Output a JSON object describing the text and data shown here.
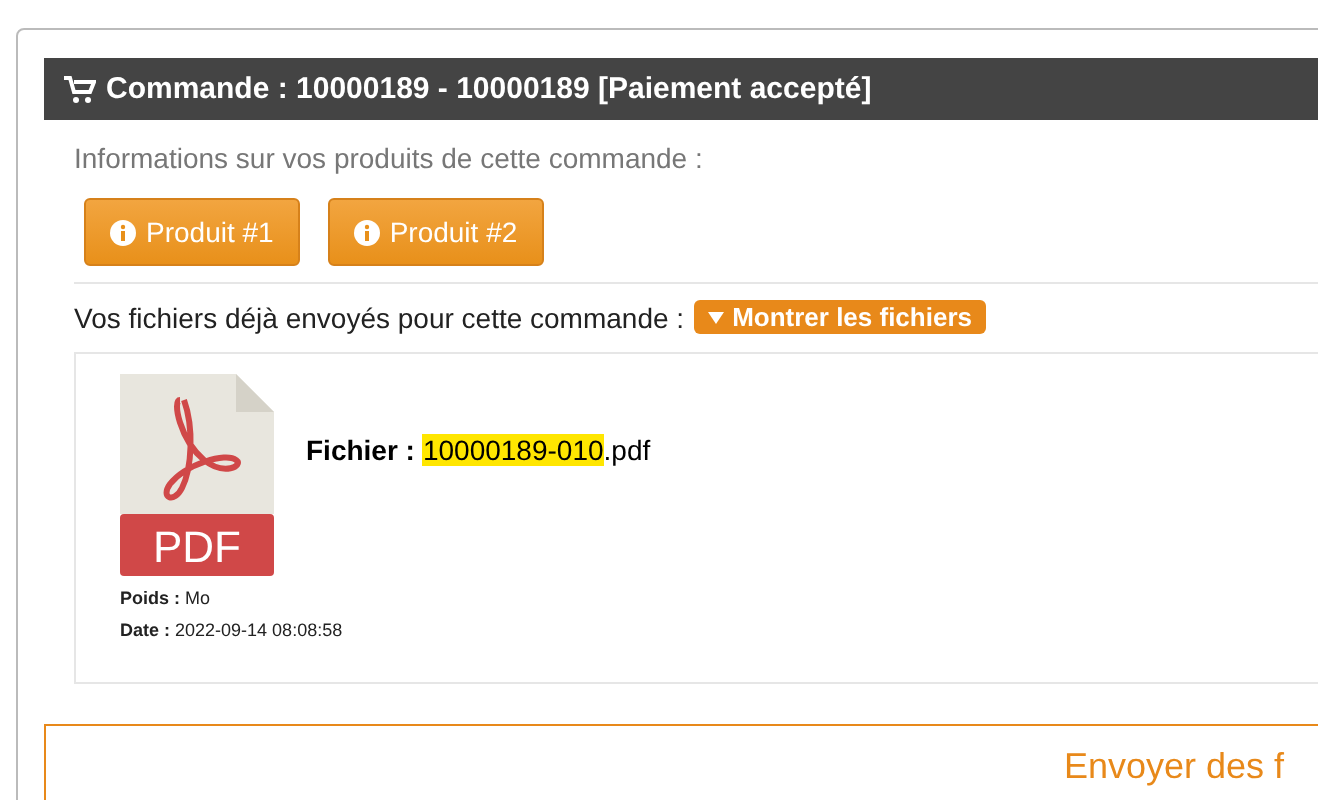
{
  "header": {
    "title": "Commande : 10000189 - 10000189 [Paiement accepté]"
  },
  "products": {
    "intro": "Informations sur vos produits de cette commande :",
    "buttons": [
      {
        "label": "Produit #1"
      },
      {
        "label": "Produit #2"
      }
    ]
  },
  "files": {
    "intro": "Vos fichiers déjà envoyés pour cette commande :",
    "toggle": "Montrer les fichiers",
    "items": [
      {
        "icon_text": "PDF",
        "label": "Fichier :",
        "name_highlighted": "10000189-010",
        "name_rest": ".pdf",
        "weight": "**Poids :** Mo",
        "date": "**Date :** 2022-09-14 08:08:58"
      }
    ]
  },
  "upload": {
    "title": "Envoyer des f"
  }
}
